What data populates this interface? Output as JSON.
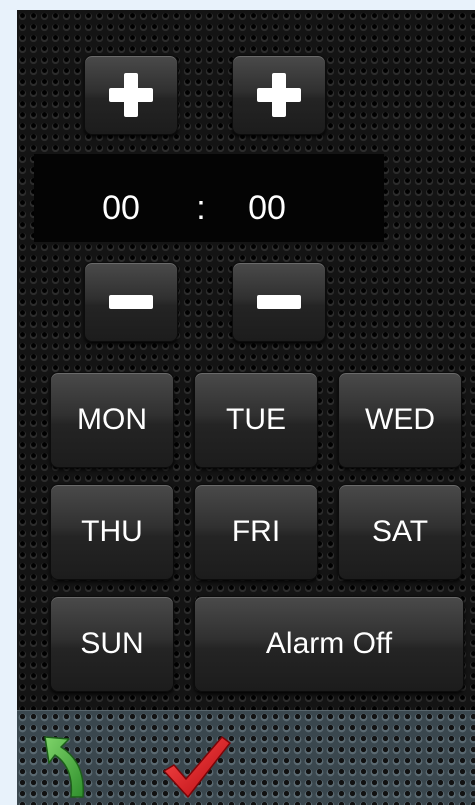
{
  "time": {
    "hours": "00",
    "separator": ":",
    "minutes": "00"
  },
  "buttons": {
    "hour_increment": "plus",
    "minute_increment": "plus",
    "hour_decrement": "minus",
    "minute_decrement": "minus"
  },
  "days": {
    "mon": "MON",
    "tue": "TUE",
    "wed": "WED",
    "thu": "THU",
    "fri": "FRI",
    "sat": "SAT",
    "sun": "SUN"
  },
  "alarm_toggle": "Alarm Off",
  "bottom_bar": {
    "back_icon": "curved-arrow-back-icon",
    "confirm_icon": "checkmark-icon",
    "back_color": "#3fae3a",
    "confirm_color": "#e0141b"
  }
}
